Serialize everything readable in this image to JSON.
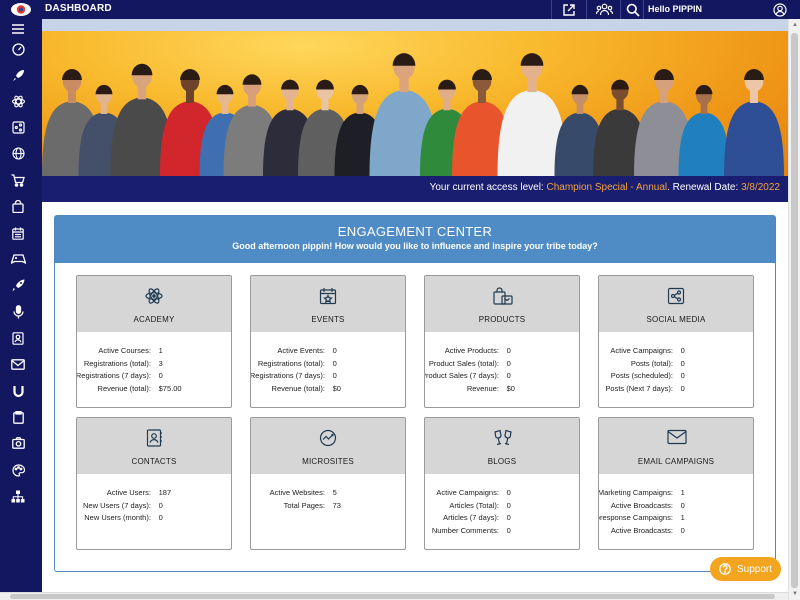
{
  "app": {
    "title": "DASHBOARD",
    "greeting": "Hello PIPPIN"
  },
  "topbar_icons": [
    "share-icon",
    "community-icon",
    "search-icon",
    "account-icon"
  ],
  "sidebar": {
    "items": [
      "menu-icon",
      "speedometer-icon",
      "rocket-launch-icon",
      "atom-icon",
      "share-box-icon",
      "globe-icon",
      "cart-icon",
      "bag-icon",
      "calendar-icon",
      "gamepad-icon",
      "rocket-icon",
      "microphone-icon",
      "contact-card-icon",
      "envelope-icon",
      "magnet-icon",
      "clipboard-icon",
      "camera-icon",
      "palette-icon",
      "sitemap-icon"
    ]
  },
  "access": {
    "prefix": "Your current access level:",
    "level": "Champion Special - Annual",
    "mid": ". Renewal Date:",
    "date": "3/8/2022"
  },
  "engagement": {
    "title": "ENGAGEMENT CENTER",
    "subtitle": "Good afternoon pippin! How would you like to influence and inspire your tribe today?"
  },
  "cards": [
    {
      "title": "ACADEMY",
      "icon": "atom-icon",
      "stats": [
        {
          "label": "Active Courses:",
          "value": "1"
        },
        {
          "label": "Registrations (total):",
          "value": "3"
        },
        {
          "label": "Registrations (7 days):",
          "value": "0"
        },
        {
          "label": "Revenue (total):",
          "value": "$75.00"
        }
      ]
    },
    {
      "title": "EVENTS",
      "icon": "calendar-star-icon",
      "stats": [
        {
          "label": "Active Events:",
          "value": "0"
        },
        {
          "label": "Registrations (total):",
          "value": "0"
        },
        {
          "label": "Registrations (7 days):",
          "value": "0"
        },
        {
          "label": "Revenue (total):",
          "value": "$0"
        }
      ]
    },
    {
      "title": "PRODUCTS",
      "icon": "shopping-bag-icon",
      "stats": [
        {
          "label": "Active Products:",
          "value": "0"
        },
        {
          "label": "Product Sales (total):",
          "value": "0"
        },
        {
          "label": "Product Sales (7 days):",
          "value": "0"
        },
        {
          "label": "Revenue:",
          "value": "$0"
        }
      ]
    },
    {
      "title": "SOCIAL MEDIA",
      "icon": "share-box-icon",
      "stats": [
        {
          "label": "Active Campaigns:",
          "value": "0"
        },
        {
          "label": "Posts (total):",
          "value": "0"
        },
        {
          "label": "Posts (scheduled):",
          "value": "0"
        },
        {
          "label": "Posts (Next 7 days):",
          "value": "0"
        }
      ]
    },
    {
      "title": "CONTACTS",
      "icon": "contact-card-icon",
      "stats": [
        {
          "label": "Active Users:",
          "value": "187"
        },
        {
          "label": "New Users (7 days):",
          "value": "0"
        },
        {
          "label": "New Users (month):",
          "value": "0"
        }
      ]
    },
    {
      "title": "MICROSITES",
      "icon": "globe-icon",
      "stats": [
        {
          "label": "Active Websites:",
          "value": "5"
        },
        {
          "label": "Total Pages:",
          "value": "73"
        }
      ]
    },
    {
      "title": "BLOGS",
      "icon": "cheers-icon",
      "stats": [
        {
          "label": "Active Campaigns:",
          "value": "0"
        },
        {
          "label": "Articles (Total):",
          "value": "0"
        },
        {
          "label": "Articles (7 days):",
          "value": "0"
        },
        {
          "label": "Number Comments:",
          "value": "0"
        }
      ]
    },
    {
      "title": "EMAIL CAMPAIGNS",
      "icon": "envelope-icon",
      "stats": [
        {
          "label": "Marketing Campaigns:",
          "value": "1"
        },
        {
          "label": "Active Broadcasts:",
          "value": "0"
        },
        {
          "label": "Autoresponse Campaigns:",
          "value": "1"
        },
        {
          "label": "Active Broadcasts:",
          "value": "0"
        }
      ]
    }
  ],
  "support": {
    "label": "Support"
  },
  "colors": {
    "nav": "#121760",
    "accent": "#f5a43a",
    "panel_header": "#4f8bc4",
    "card_header": "#d6d6d6"
  }
}
